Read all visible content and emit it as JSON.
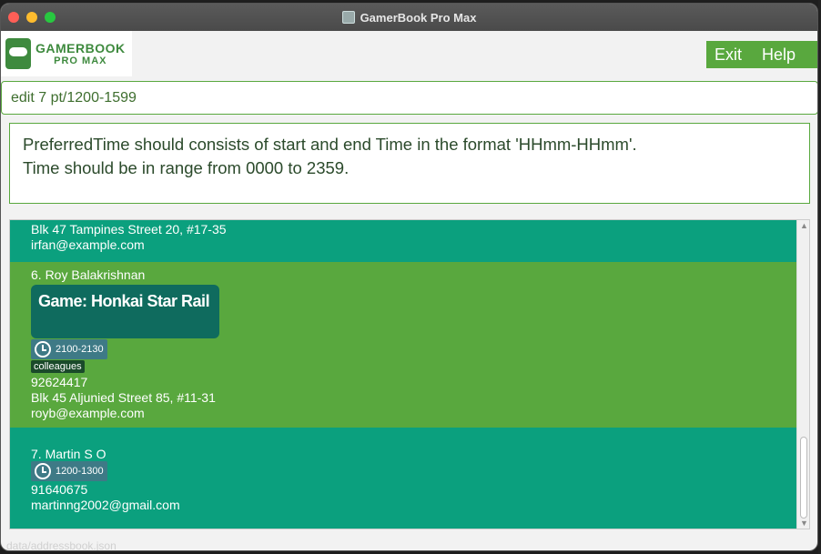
{
  "window": {
    "title": "GamerBook Pro Max"
  },
  "logo": {
    "main": "GAMERBOOK",
    "sub": "PRO MAX"
  },
  "menu": {
    "exit_label": "Exit",
    "help_label": "Help"
  },
  "command": {
    "value": "edit 7 pt/1200-1599"
  },
  "result": {
    "line1": "PreferredTime should consists of start and end Time in the format 'HHmm-HHmm'.",
    "line2": "Time should be in range from 0000 to 2359."
  },
  "persons": [
    {
      "address": "Blk 47 Tampines Street 20, #17-35",
      "email": "irfan@example.com"
    },
    {
      "name": "6. Roy Balakrishnan",
      "game": "Game: Honkai Star Rail",
      "time": "2100-2130",
      "tag": "colleagues",
      "phone": "92624417",
      "address": "Blk 45 Aljunied Street 85, #11-31",
      "email": "royb@example.com"
    },
    {
      "name": "7. Martin S O",
      "time": "1200-1300",
      "phone": "91640675",
      "email": "martinng2002@gmail.com"
    }
  ],
  "status": {
    "path": "data/addressbook.json"
  },
  "colors": {
    "green": "#59a83e",
    "teal": "#0ba07e",
    "dark_teal": "#0f6b5e"
  },
  "icons": {
    "clock": "clock-icon",
    "logo": "gamepad-icon"
  }
}
